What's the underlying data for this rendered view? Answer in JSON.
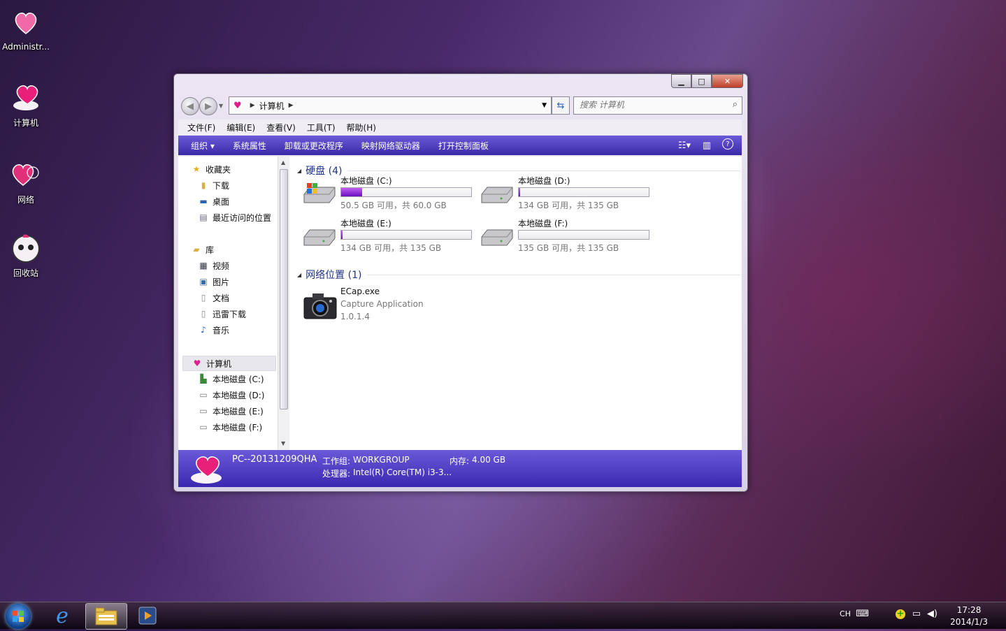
{
  "desktop": {
    "icons": [
      {
        "label": "Administr..."
      },
      {
        "label": "计算机"
      },
      {
        "label": "网络"
      },
      {
        "label": "回收站"
      }
    ]
  },
  "window": {
    "address": {
      "crumb": "计算机"
    },
    "search": {
      "placeholder": "搜索 计算机"
    },
    "menu": [
      "文件(F)",
      "编辑(E)",
      "查看(V)",
      "工具(T)",
      "帮助(H)"
    ],
    "commands": [
      "组织 ▾",
      "系统属性",
      "卸载或更改程序",
      "映射网络驱动器",
      "打开控制面板"
    ],
    "nav": {
      "favorites": {
        "label": "收藏夹",
        "items": [
          "下载",
          "桌面",
          "最近访问的位置"
        ]
      },
      "libraries": {
        "label": "库",
        "items": [
          "视频",
          "图片",
          "文档",
          "迅雷下载",
          "音乐"
        ]
      },
      "computer": {
        "label": "计算机",
        "items": [
          "本地磁盘 (C:)",
          "本地磁盘 (D:)",
          "本地磁盘 (E:)",
          "本地磁盘 (F:)"
        ]
      }
    },
    "groups": {
      "harddisks": "硬盘 (4)",
      "network": "网络位置 (1)"
    },
    "drives": [
      {
        "name": "本地磁盘 (C:)",
        "free": "50.5 GB 可用，共 60.0 GB",
        "used_fraction": 0.16
      },
      {
        "name": "本地磁盘 (D:)",
        "free": "134 GB 可用，共 135 GB",
        "used_fraction": 0.01
      },
      {
        "name": "本地磁盘 (E:)",
        "free": "134 GB 可用，共 135 GB",
        "used_fraction": 0.01
      },
      {
        "name": "本地磁盘 (F:)",
        "free": "135 GB 可用，共 135 GB",
        "used_fraction": 0.0
      }
    ],
    "app": {
      "name": "ECap.exe",
      "desc": "Capture Application",
      "version": "1.0.1.4"
    },
    "details": {
      "pc_name": "PC--20131209QHA",
      "workgroup_label": "工作组:",
      "workgroup": "WORKGROUP",
      "memory_label": "内存:",
      "memory": "4.00 GB",
      "cpu_label": "处理器:",
      "cpu": "Intel(R) Core(TM) i3-3..."
    }
  },
  "taskbar": {
    "lang": "CH",
    "time": "17:28",
    "date": "2014/1/3"
  },
  "colors": {
    "accent": "#4a38c0",
    "drive_fill": "#9a30e0",
    "group_text": "#1e3287"
  }
}
